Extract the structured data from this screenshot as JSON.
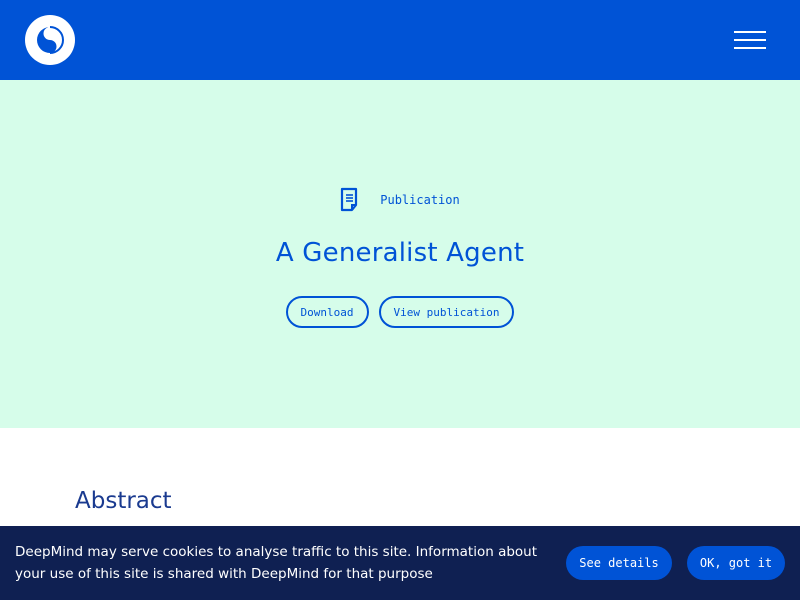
{
  "header": {
    "logo_icon": "deepmind-logo-icon",
    "menu_icon": "hamburger-menu-icon",
    "background": "#0053d6"
  },
  "hero": {
    "background": "#d6fdea",
    "label_icon": "document-icon",
    "label": "Publication",
    "title": "A Generalist Agent",
    "buttons": {
      "download": "Download",
      "view": "View publication"
    }
  },
  "content": {
    "abstract_heading": "Abstract"
  },
  "cookie_banner": {
    "text": "DeepMind may serve cookies to analyse traffic to this site. Information about your use of this site is shared with DeepMind for that purpose",
    "details_label": "See details",
    "ok_label": "OK, got it",
    "background": "#0f2052"
  }
}
